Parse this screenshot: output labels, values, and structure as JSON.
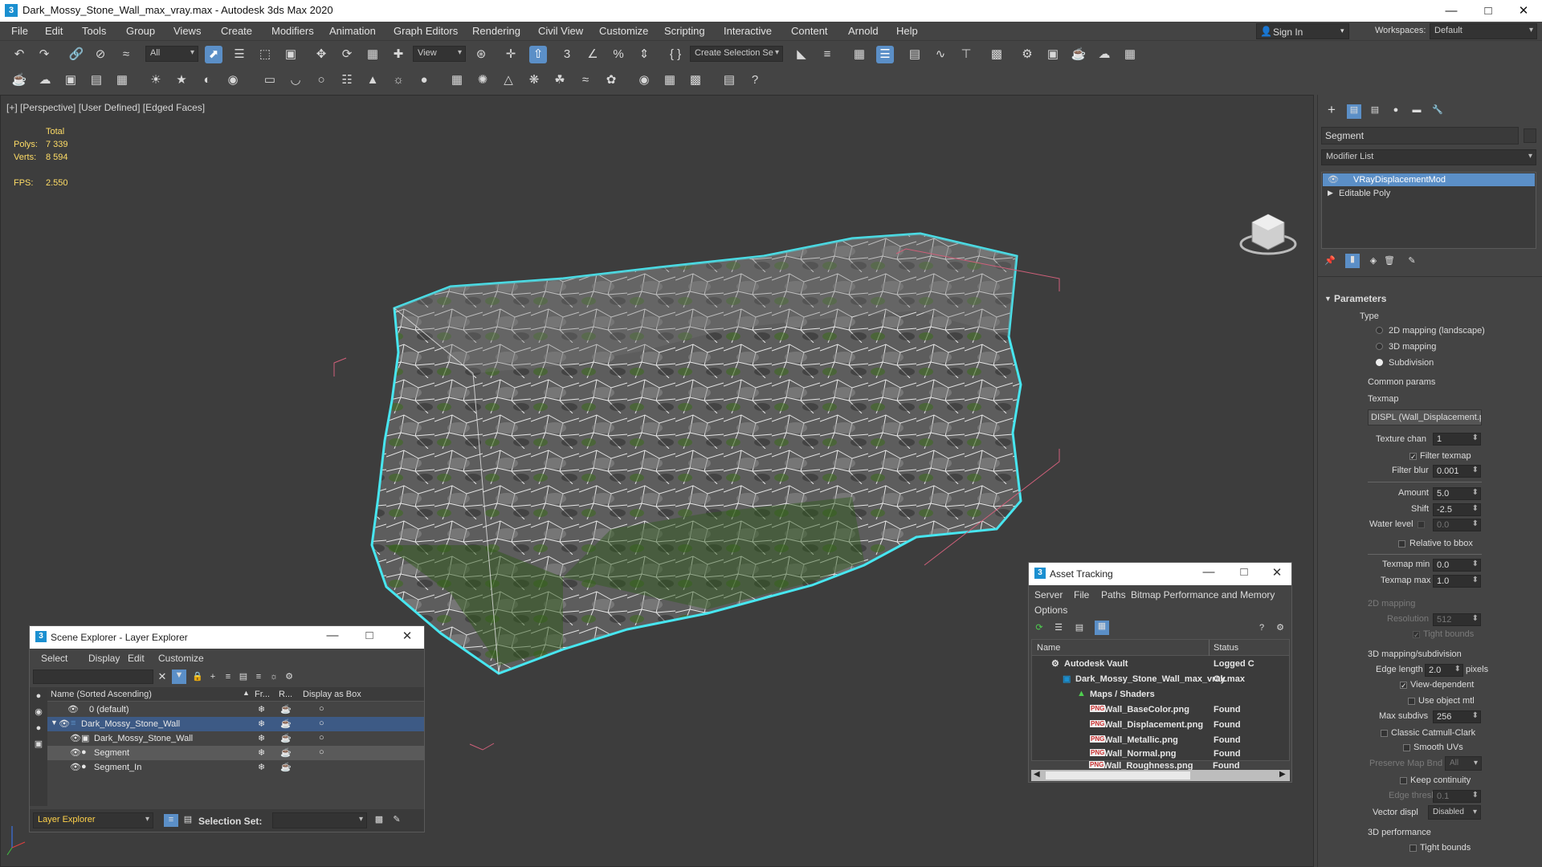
{
  "window": {
    "title": "Dark_Mossy_Stone_Wall_max_vray.max - Autodesk 3ds Max 2020",
    "app_icon": "3"
  },
  "menu": [
    "File",
    "Edit",
    "Tools",
    "Group",
    "Views",
    "Create",
    "Modifiers",
    "Animation",
    "Graph Editors",
    "Rendering",
    "Civil View",
    "Customize",
    "Scripting",
    "Interactive",
    "Content",
    "Arnold",
    "Help"
  ],
  "account": {
    "sign_in": "Sign In",
    "workspaces_label": "Workspaces:",
    "workspace": "Default"
  },
  "toolbar": {
    "filter": "All",
    "ref_coord": "View",
    "selection_set": "Create Selection Se"
  },
  "viewport": {
    "label": "[+] [Perspective] [User Defined] [Edged Faces]",
    "stats": {
      "total_label": "Total",
      "polys_label": "Polys:",
      "polys": "7 339",
      "verts_label": "Verts:",
      "verts": "8 594",
      "fps_label": "FPS:",
      "fps": "2.550"
    }
  },
  "command_panel": {
    "object_name": "Segment",
    "modifier_list": "Modifier List",
    "stack": [
      "VRayDisplacementMod",
      "Editable Poly"
    ],
    "rollout_title": "Parameters",
    "type_group": "Type",
    "type_options": [
      "2D mapping (landscape)",
      "3D mapping",
      "Subdivision"
    ],
    "type_selected": 2,
    "common_params": "Common params",
    "texmap_label": "Texmap",
    "texmap_value": "DISPL (Wall_Displacement.png",
    "texture_chan_label": "Texture chan",
    "texture_chan": "1",
    "filter_texmap": "Filter texmap",
    "filter_blur_label": "Filter blur",
    "filter_blur": "0.001",
    "amount_label": "Amount",
    "amount": "5.0",
    "shift_label": "Shift",
    "shift": "-2.5",
    "water_level_label": "Water level",
    "water_level": "0.0",
    "relative_bbox": "Relative to bbox",
    "texmap_min_label": "Texmap min",
    "texmap_min": "0.0",
    "texmap_max_label": "Texmap max",
    "texmap_max": "1.0",
    "mapping2d": "2D mapping",
    "resolution_label": "Resolution",
    "resolution": "512",
    "tight_bounds": "Tight bounds",
    "mapping3d": "3D mapping/subdivision",
    "edge_length_label": "Edge length",
    "edge_length": "2.0",
    "edge_length_unit": "pixels",
    "view_dependent": "View-dependent",
    "use_object_mtl": "Use object mtl",
    "max_subdivs_label": "Max subdivs",
    "max_subdivs": "256",
    "classic_catmull": "Classic Catmull-Clark",
    "smooth_uvs": "Smooth UVs",
    "preserve_map_bnd_label": "Preserve Map Bnd",
    "preserve_map_bnd": "All",
    "keep_continuity": "Keep continuity",
    "edge_thresh_label": "Edge thresh",
    "edge_thresh": "0.1",
    "vector_displ_label": "Vector displ",
    "vector_displ": "Disabled",
    "perf3d": "3D performance",
    "tight_bounds2": "Tight bounds"
  },
  "scene_explorer": {
    "title": "Scene Explorer - Layer Explorer",
    "menus": [
      "Select",
      "Display",
      "Edit",
      "Customize"
    ],
    "columns": [
      "Name (Sorted Ascending)",
      "Fr...",
      "R...",
      "Display as Box"
    ],
    "rows": [
      {
        "name": "0 (default)"
      },
      {
        "name": "Dark_Mossy_Stone_Wall"
      },
      {
        "name": "Dark_Mossy_Stone_Wall"
      },
      {
        "name": "Segment"
      },
      {
        "name": "Segment_In"
      }
    ],
    "footer_mode": "Layer Explorer",
    "selection_set_label": "Selection Set:"
  },
  "asset_tracking": {
    "title": "Asset Tracking",
    "menus": [
      "Server",
      "File",
      "Paths",
      "Bitmap Performance and Memory"
    ],
    "menu2": "Options",
    "columns": [
      "Name",
      "Status"
    ],
    "rows": [
      {
        "name": "Autodesk Vault",
        "status": "Logged C"
      },
      {
        "name": "Dark_Mossy_Stone_Wall_max_vray.max",
        "status": "Ok"
      },
      {
        "name": "Maps / Shaders",
        "status": ""
      },
      {
        "name": "Wall_BaseColor.png",
        "status": "Found"
      },
      {
        "name": "Wall_Displacement.png",
        "status": "Found"
      },
      {
        "name": "Wall_Metallic.png",
        "status": "Found"
      },
      {
        "name": "Wall_Normal.png",
        "status": "Found"
      },
      {
        "name": "Wall_Roughness.png",
        "status": "Found"
      }
    ]
  },
  "colors": {
    "selection_blue": "#5b8fc7",
    "outline_cyan": "#47e6f0",
    "bbox_pink": "#d0607a",
    "stats_yellow": "#ffdd66",
    "moss_green": "#3e6b22"
  }
}
